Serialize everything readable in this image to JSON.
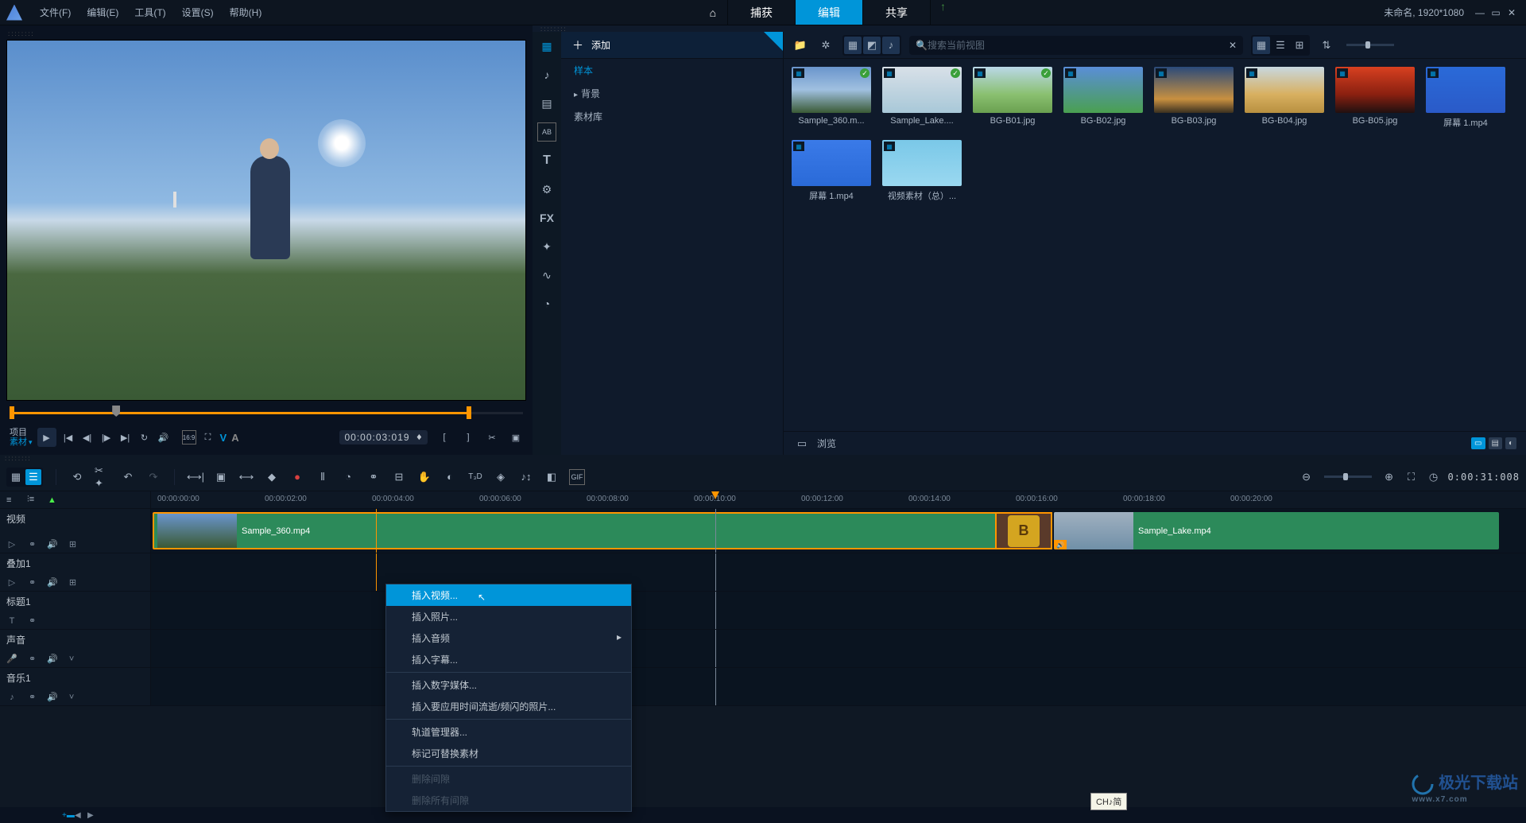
{
  "menu": {
    "file": "文件(F)",
    "edit": "编辑(E)",
    "tools": "工具(T)",
    "settings": "设置(S)",
    "help": "帮助(H)"
  },
  "nav": {
    "home": "⌂",
    "capture": "捕获",
    "edit": "编辑",
    "share": "共享"
  },
  "header": {
    "project_info": "未命名, 1920*1080"
  },
  "preview": {
    "src_label": "项目",
    "mat_label": "素材",
    "timecode": "00:00:03:019",
    "aspect": "16:9",
    "v": "V",
    "a": "A"
  },
  "library": {
    "add_label": "添加",
    "tree": {
      "sample": "样本",
      "background": "背景",
      "assets": "素材库"
    },
    "search_placeholder": "搜索当前视图",
    "browse": "浏览",
    "items": [
      {
        "label": "Sample_360.m...",
        "g": "linear-gradient(to bottom,#6a95cc 0%,#a0c0e0 50%,#3a5a35 100%)",
        "check": true
      },
      {
        "label": "Sample_Lake....",
        "g": "linear-gradient(to bottom,#d8e0e8,#a8c8d8)",
        "check": true
      },
      {
        "label": "BG-B01.jpg",
        "g": "linear-gradient(to bottom,#bad8e8,#8ac070 60%,#6aa050)",
        "check": true
      },
      {
        "label": "BG-B02.jpg",
        "g": "linear-gradient(to bottom,#5a8ed8,#4aa050)"
      },
      {
        "label": "BG-B03.jpg",
        "g": "linear-gradient(to bottom,#2a4a7a,#c89040 70%,#3a3020)"
      },
      {
        "label": "BG-B04.jpg",
        "g": "linear-gradient(to bottom,#c8d8e0,#d8b060 60%,#b89040)"
      },
      {
        "label": "BG-B05.jpg",
        "g": "linear-gradient(to bottom,#d84020,#8a2010 60%,#201010)"
      },
      {
        "label": "屏幕 1.mp4",
        "g": "linear-gradient(to bottom,#2a6ad8,#2a5ac8)"
      },
      {
        "label": "屏幕 1.mp4",
        "g": "linear-gradient(to bottom,#3a7ae8,#2a6ad8)"
      },
      {
        "label": "视频素材（总）...",
        "g": "linear-gradient(to bottom,#7ac8e8,#9ad8f0)"
      }
    ]
  },
  "timeline": {
    "ticks": [
      "00:00:00:00",
      "00:00:02:00",
      "00:00:04:00",
      "00:00:06:00",
      "00:00:08:00",
      "00:00:10:00",
      "00:00:12:00",
      "00:00:14:00",
      "00:00:16:00",
      "00:00:18:00",
      "00:00:20:00"
    ],
    "current": "0:00:31:008",
    "tracks": {
      "video": "视频",
      "overlay1": "叠加1",
      "title1": "标题1",
      "voice": "声音",
      "music1": "音乐1"
    },
    "clip1": "Sample_360.mp4",
    "clip2": "Sample_Lake.mp4"
  },
  "context_menu": {
    "insert_video": "插入视频...",
    "insert_photo": "插入照片...",
    "insert_audio": "插入音频",
    "insert_subtitle": "插入字幕...",
    "insert_digital": "插入数字媒体...",
    "insert_timelapse": "插入要应用时间流逝/频闪的照片...",
    "track_manager": "轨道管理器...",
    "mark_replaceable": "标记可替换素材",
    "delete_gap": "删除间隙",
    "delete_all_gaps": "删除所有间隙"
  },
  "tooltip": "CH♪简"
}
